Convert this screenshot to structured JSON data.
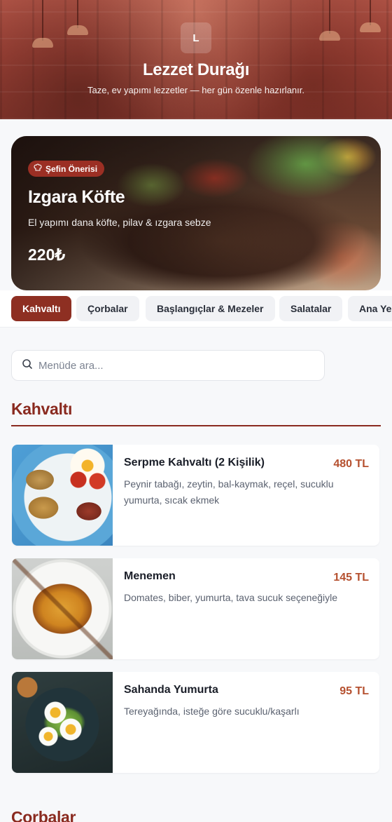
{
  "header": {
    "logo_letter": "L",
    "title": "Lezzet Durağı",
    "tagline": "Taze, ev yapımı lezzetler — her gün özenle hazırlanır."
  },
  "hero": {
    "badge": "Şefin Önerisi",
    "badge_icon": "chef-hat-icon",
    "name": "Izgara Köfte",
    "description": "El yapımı dana köfte, pilav & ızgara sebze",
    "price": "220₺"
  },
  "tabs": [
    {
      "label": "Kahvaltı",
      "active": true
    },
    {
      "label": "Çorbalar",
      "active": false
    },
    {
      "label": "Başlangıçlar & Mezeler",
      "active": false
    },
    {
      "label": "Salatalar",
      "active": false
    },
    {
      "label": "Ana Yemekler",
      "active": false
    }
  ],
  "search": {
    "placeholder": "Menüde ara...",
    "icon": "search-icon"
  },
  "sections": [
    {
      "title": "Kahvaltı",
      "items": [
        {
          "name": "Serpme Kahvaltı (2 Kişilik)",
          "price": "480 TL",
          "description": "Peynir tabağı, zeytin, bal-kaymak, reçel, sucuklu yumurta, sıcak ekmek"
        },
        {
          "name": "Menemen",
          "price": "145 TL",
          "description": "Domates, biber, yumurta, tava sucuk seçeneğiyle"
        },
        {
          "name": "Sahanda Yumurta",
          "price": "95 TL",
          "description": "Tereyağında, isteğe göre sucuklu/kaşarlı"
        }
      ]
    },
    {
      "title": "Çorbalar",
      "items": []
    }
  ],
  "colors": {
    "accent": "#8e2f22",
    "price": "#b5502f",
    "section_title": "#8a2a1f"
  }
}
